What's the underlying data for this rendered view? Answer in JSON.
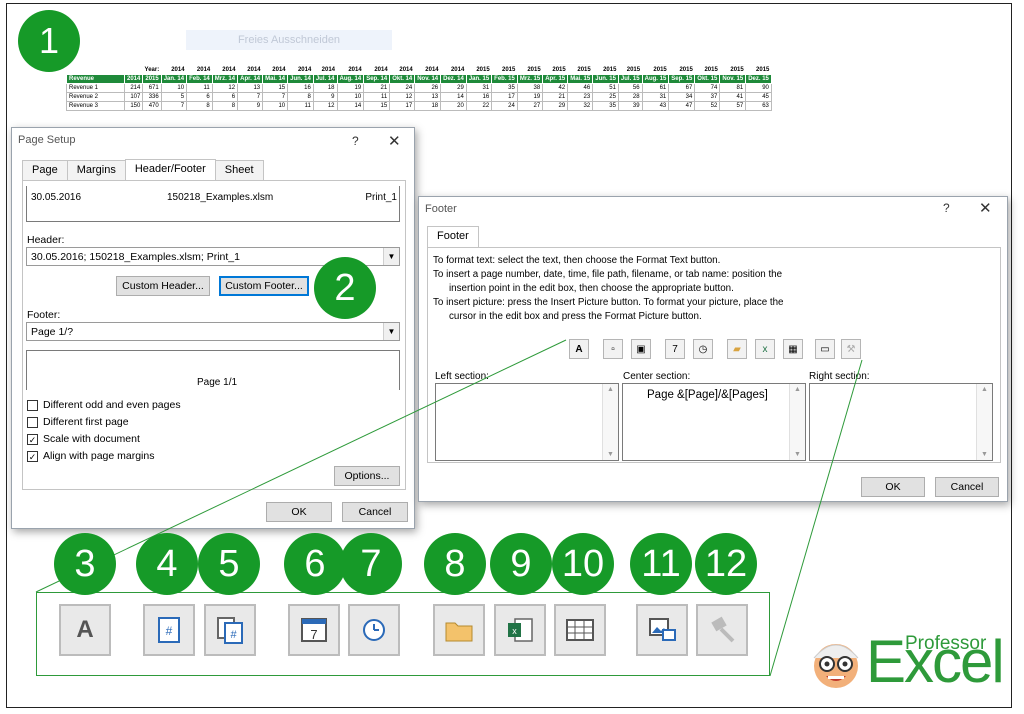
{
  "markers": [
    "1",
    "2",
    "3",
    "4",
    "5",
    "6",
    "7",
    "8",
    "9",
    "10",
    "11",
    "12"
  ],
  "sheet": {
    "cut_label": "Freies Ausschneiden",
    "year_label": "Year",
    "years": [
      "2014",
      "2014",
      "2014",
      "2014",
      "2014",
      "2014",
      "2014",
      "2014",
      "2014",
      "2014",
      "2014",
      "2014",
      "2015",
      "2015",
      "2015",
      "2015",
      "2015",
      "2015",
      "2015",
      "2015",
      "2015",
      "2015",
      "2015",
      "2015"
    ],
    "header": [
      "Revenue",
      "2014",
      "2015",
      "Jan. 14",
      "Feb. 14",
      "Mrz. 14",
      "Apr. 14",
      "Mai. 14",
      "Jun. 14",
      "Jul. 14",
      "Aug. 14",
      "Sep. 14",
      "Okt. 14",
      "Nov. 14",
      "Dez. 14",
      "Jan. 15",
      "Feb. 15",
      "Mrz. 15",
      "Apr. 15",
      "Mai. 15",
      "Jun. 15",
      "Jul. 15",
      "Aug. 15",
      "Sep. 15",
      "Okt. 15",
      "Nov. 15",
      "Dez. 15"
    ],
    "rows": [
      [
        "Revenue 1",
        "214",
        "671",
        "10",
        "11",
        "12",
        "13",
        "15",
        "16",
        "18",
        "19",
        "21",
        "24",
        "26",
        "29",
        "31",
        "35",
        "38",
        "42",
        "46",
        "51",
        "56",
        "61",
        "67",
        "74",
        "81",
        "90"
      ],
      [
        "Revenue 2",
        "107",
        "336",
        "5",
        "6",
        "6",
        "7",
        "7",
        "8",
        "9",
        "10",
        "11",
        "12",
        "13",
        "14",
        "16",
        "17",
        "19",
        "21",
        "23",
        "25",
        "28",
        "31",
        "34",
        "37",
        "41",
        "45"
      ],
      [
        "Revenue 3",
        "150",
        "470",
        "7",
        "8",
        "8",
        "9",
        "10",
        "11",
        "12",
        "14",
        "15",
        "17",
        "18",
        "20",
        "22",
        "24",
        "27",
        "29",
        "32",
        "35",
        "39",
        "43",
        "47",
        "52",
        "57",
        "63"
      ]
    ]
  },
  "page_setup": {
    "title": "Page Setup",
    "help": "?",
    "close": "✕",
    "tabs": [
      "Page",
      "Margins",
      "Header/Footer",
      "Sheet"
    ],
    "preview_header": {
      "left": "30.05.2016",
      "center": "150218_Examples.xlsm",
      "right": "Print_1"
    },
    "header_label": "Header:",
    "header_value": "30.05.2016; 150218_Examples.xlsm; Print_1",
    "custom_header": "Custom Header...",
    "custom_footer": "Custom Footer...",
    "footer_label": "Footer:",
    "footer_value": "Page 1/?",
    "preview_footer": "Page 1/1",
    "checkboxes": [
      {
        "label": "Different odd and even pages",
        "checked": false
      },
      {
        "label": "Different first page",
        "checked": false
      },
      {
        "label": "Scale with document",
        "checked": true
      },
      {
        "label": "Align with page margins",
        "checked": true
      }
    ],
    "options": "Options...",
    "ok": "OK",
    "cancel": "Cancel"
  },
  "footer_dialog": {
    "title": "Footer",
    "help": "?",
    "close": "✕",
    "tab": "Footer",
    "instructions": [
      "To format text:  select the text, then choose the Format Text button.",
      "To insert a page number, date, time, file path, filename, or tab name:  position the",
      "insertion point in the edit box, then choose the appropriate button.",
      "To insert picture: press the Insert Picture button.  To format your picture, place the",
      "cursor in the edit box and press the Format Picture button."
    ],
    "left_label": "Left section:",
    "center_label": "Center section:",
    "right_label": "Right section:",
    "center_value": "Page &[Page]/&[Pages]",
    "ok": "OK",
    "cancel": "Cancel"
  },
  "logo": {
    "top": "Professor",
    "main": "Excel"
  },
  "accent": "#169a28"
}
